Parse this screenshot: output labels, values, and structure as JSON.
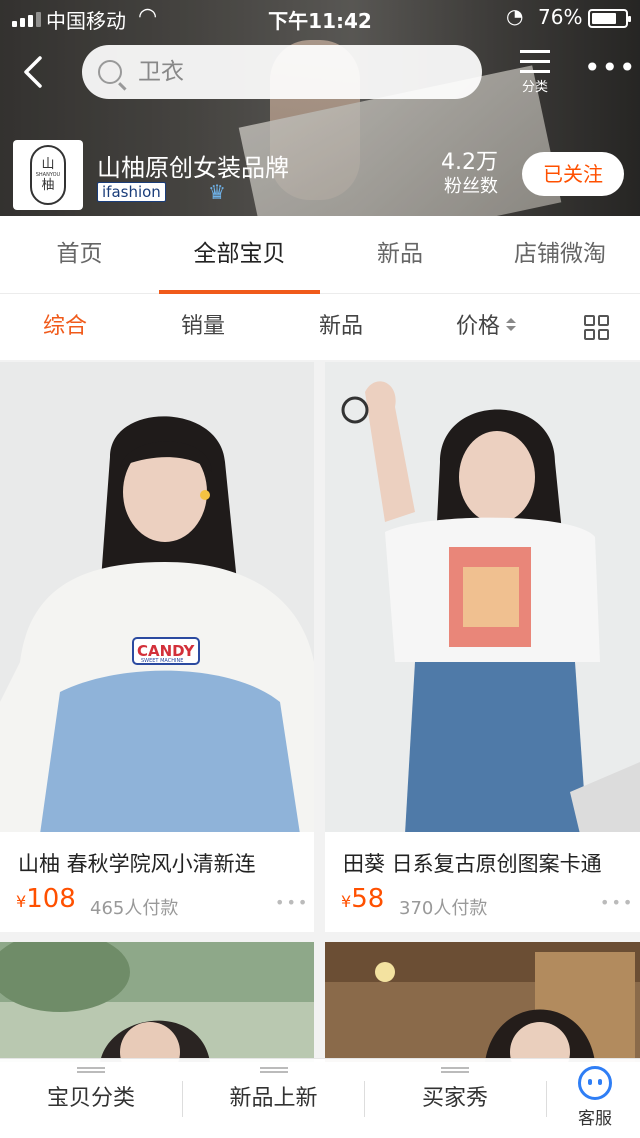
{
  "status_bar": {
    "carrier": "中国移动",
    "time": "下午11:42",
    "battery": "76%",
    "battery_level": 0.76
  },
  "search": {
    "placeholder": "卫衣"
  },
  "header_actions": {
    "category_label": "分类",
    "more_icon": "more-dots-icon"
  },
  "shop": {
    "logo_top": "山",
    "logo_sub": "SHANYOU",
    "logo_bottom": "柚",
    "name": "山柚原创女装品牌",
    "badge": "ifashion",
    "fans_count": "4.2万",
    "fans_label": "粉丝数",
    "follow_label": "已关注"
  },
  "tabs": [
    {
      "label": "首页",
      "active": false
    },
    {
      "label": "全部宝贝",
      "active": true
    },
    {
      "label": "新品",
      "active": false
    },
    {
      "label": "店铺微淘",
      "active": false
    }
  ],
  "sort_options": [
    {
      "label": "综合",
      "active": true
    },
    {
      "label": "销量",
      "active": false
    },
    {
      "label": "新品",
      "active": false
    },
    {
      "label": "价格",
      "active": false
    }
  ],
  "products": [
    {
      "title": "山柚 春秋学院风小清新连",
      "currency": "¥",
      "price": "108",
      "paid": "465人付款",
      "print_text": "CANDY",
      "print_sub": "SWEET MACHINE"
    },
    {
      "title": "田葵 日系复古原创图案卡通",
      "currency": "¥",
      "price": "58",
      "paid": "370人付款"
    }
  ],
  "bottom_bar": {
    "items": [
      "宝贝分类",
      "新品上新",
      "买家秀"
    ],
    "service_label": "客服"
  },
  "colors": {
    "accent": "#f05a1a",
    "price": "#ff5000",
    "service": "#2f7ef5"
  }
}
